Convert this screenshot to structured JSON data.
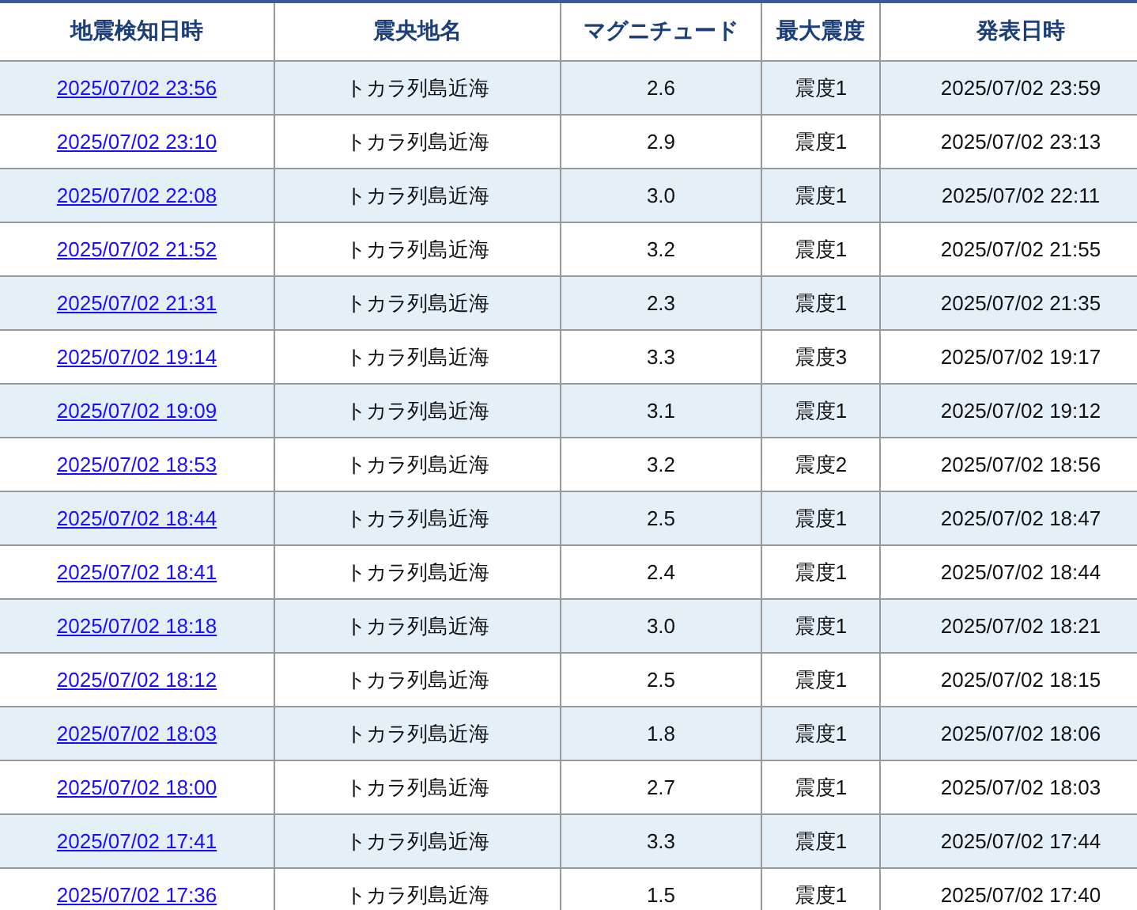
{
  "table": {
    "columns": [
      "地震検知日時",
      "震央地名",
      "マグニチュード",
      "最大震度",
      "発表日時"
    ],
    "rows": [
      {
        "detected": "2025/07/02 23:56",
        "epicenter": "トカラ列島近海",
        "magnitude": "2.6",
        "intensity": "震度1",
        "announced": "2025/07/02 23:59"
      },
      {
        "detected": "2025/07/02 23:10",
        "epicenter": "トカラ列島近海",
        "magnitude": "2.9",
        "intensity": "震度1",
        "announced": "2025/07/02 23:13"
      },
      {
        "detected": "2025/07/02 22:08",
        "epicenter": "トカラ列島近海",
        "magnitude": "3.0",
        "intensity": "震度1",
        "announced": "2025/07/02 22:11"
      },
      {
        "detected": "2025/07/02 21:52",
        "epicenter": "トカラ列島近海",
        "magnitude": "3.2",
        "intensity": "震度1",
        "announced": "2025/07/02 21:55"
      },
      {
        "detected": "2025/07/02 21:31",
        "epicenter": "トカラ列島近海",
        "magnitude": "2.3",
        "intensity": "震度1",
        "announced": "2025/07/02 21:35"
      },
      {
        "detected": "2025/07/02 19:14",
        "epicenter": "トカラ列島近海",
        "magnitude": "3.3",
        "intensity": "震度3",
        "announced": "2025/07/02 19:17"
      },
      {
        "detected": "2025/07/02 19:09",
        "epicenter": "トカラ列島近海",
        "magnitude": "3.1",
        "intensity": "震度1",
        "announced": "2025/07/02 19:12"
      },
      {
        "detected": "2025/07/02 18:53",
        "epicenter": "トカラ列島近海",
        "magnitude": "3.2",
        "intensity": "震度2",
        "announced": "2025/07/02 18:56"
      },
      {
        "detected": "2025/07/02 18:44",
        "epicenter": "トカラ列島近海",
        "magnitude": "2.5",
        "intensity": "震度1",
        "announced": "2025/07/02 18:47"
      },
      {
        "detected": "2025/07/02 18:41",
        "epicenter": "トカラ列島近海",
        "magnitude": "2.4",
        "intensity": "震度1",
        "announced": "2025/07/02 18:44"
      },
      {
        "detected": "2025/07/02 18:18",
        "epicenter": "トカラ列島近海",
        "magnitude": "3.0",
        "intensity": "震度1",
        "announced": "2025/07/02 18:21"
      },
      {
        "detected": "2025/07/02 18:12",
        "epicenter": "トカラ列島近海",
        "magnitude": "2.5",
        "intensity": "震度1",
        "announced": "2025/07/02 18:15"
      },
      {
        "detected": "2025/07/02 18:03",
        "epicenter": "トカラ列島近海",
        "magnitude": "1.8",
        "intensity": "震度1",
        "announced": "2025/07/02 18:06"
      },
      {
        "detected": "2025/07/02 18:00",
        "epicenter": "トカラ列島近海",
        "magnitude": "2.7",
        "intensity": "震度1",
        "announced": "2025/07/02 18:03"
      },
      {
        "detected": "2025/07/02 17:41",
        "epicenter": "トカラ列島近海",
        "magnitude": "3.3",
        "intensity": "震度1",
        "announced": "2025/07/02 17:44"
      },
      {
        "detected": "2025/07/02 17:36",
        "epicenter": "トカラ列島近海",
        "magnitude": "1.5",
        "intensity": "震度1",
        "announced": "2025/07/02 17:40"
      }
    ]
  }
}
